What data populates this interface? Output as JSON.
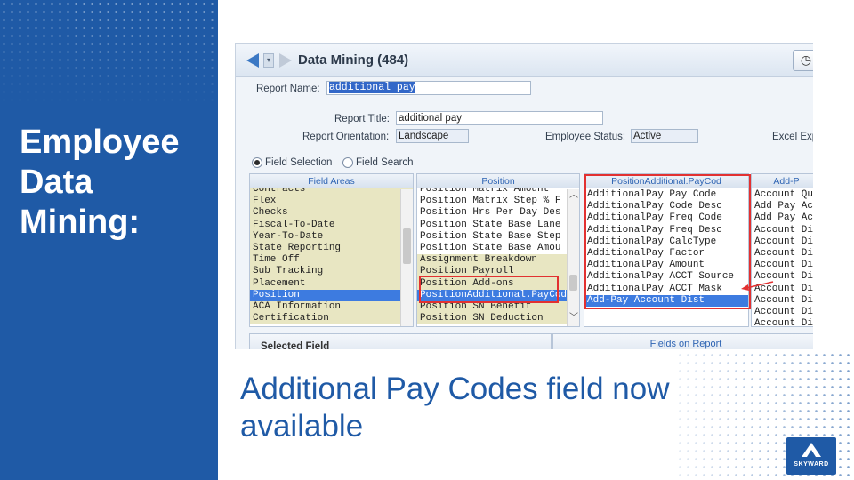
{
  "slide": {
    "heading": "Employee Data Mining:",
    "caption": "Additional Pay Codes field now available",
    "logo_text": "SKYWARD"
  },
  "window": {
    "title": "Data Mining (484)",
    "icons": {
      "back": "back-arrow-icon",
      "dropdown": "history-dropdown-icon",
      "forward": "forward-arrow-icon",
      "action": "clock-icon"
    }
  },
  "form": {
    "report_name_label": "Report Name:",
    "report_name_value": "additional pay",
    "report_title_label": "Report Title:",
    "report_title_value": "additional pay",
    "orientation_label": "Report Orientation:",
    "orientation_value": "Landscape",
    "employee_status_label": "Employee Status:",
    "employee_status_value": "Active",
    "excel_label": "Excel Exp",
    "mode_field_selection": "Field Selection",
    "mode_field_search": "Field Search",
    "selected_mode": "Field Selection"
  },
  "panels": {
    "field_areas": {
      "header": "Field Areas",
      "items": [
        "Contracts",
        "Flex",
        "Checks",
        "Fiscal-To-Date",
        "Year-To-Date",
        "State Reporting",
        "Time Off",
        "Sub Tracking",
        "Placement",
        "Position",
        "ACA Information",
        "Certification"
      ],
      "selected": "Position"
    },
    "position": {
      "header": "Position",
      "items": [
        "Position Matrix Amount",
        "Position Matrix Step % F",
        "Position Hrs Per Day Des",
        "Position State Base Lane",
        "Position State Base Step",
        "Position State Base Amou",
        "Assignment Breakdown",
        "Position Payroll",
        "Position Add-ons",
        "PositionAdditional.PayCod",
        "Position SN Benefit",
        "Position SN Deduction"
      ],
      "selected": "PositionAdditional.PayCod"
    },
    "pay_code": {
      "header": "PositionAdditional.PayCod",
      "items": [
        "AdditionalPay Pay Code",
        "AdditionalPay Code Desc",
        "AdditionalPay Freq Code",
        "AdditionalPay Freq Desc",
        "AdditionalPay CalcType",
        "AdditionalPay Factor",
        "AdditionalPay Amount",
        "AdditionalPay ACCT Source",
        "AdditionalPay ACCT Mask",
        "Add-Pay Account Dist"
      ],
      "selected": "Add-Pay Account Dist"
    },
    "add_pay": {
      "header": "Add-P",
      "items": [
        "Account Qu",
        "Add Pay Ac",
        "Add Pay Ac",
        "Account Di",
        "Account Di",
        "Account Di",
        "Account Di",
        "Account Di",
        "Account Di",
        "Account Di",
        "Account Di",
        "Account Di"
      ]
    }
  },
  "bottom": {
    "selected_field": "Selected Field",
    "fields_on_report": "Fields on Report"
  },
  "colors": {
    "brand_blue": "#1f5aa6",
    "highlight_red": "#e23131",
    "selection_blue": "#3d7be0",
    "olive": "#e8e6c2"
  }
}
